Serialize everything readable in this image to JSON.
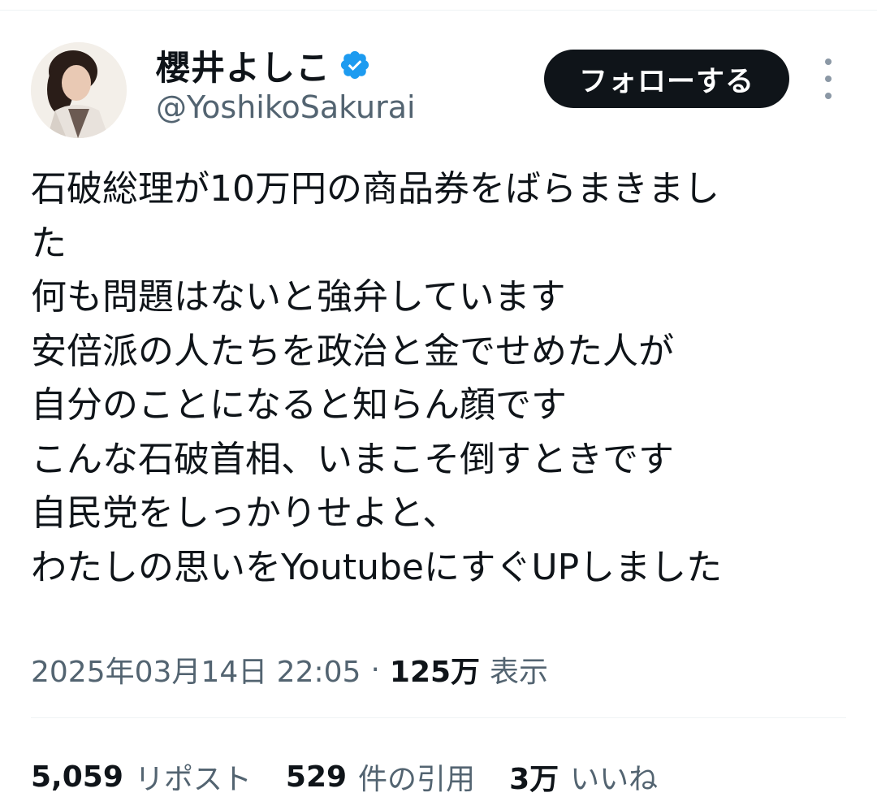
{
  "author": {
    "display_name": "櫻井よしこ",
    "handle": "@YoshikoSakurai",
    "verified": true,
    "avatar_icon": "profile-photo"
  },
  "actions": {
    "follow_label": "フォローする",
    "more_icon": "more-vertical-icon"
  },
  "tweet": {
    "lines": [
      "石破総理が10万円の商品券をばらまきまし",
      "た",
      "何も問題はないと強弁しています",
      "安倍派の人たちを政治と金でせめた人が",
      "自分のことになると知らん顔です",
      "こんな石破首相、いまこそ倒すときです",
      "自民党をしっかりせよと、",
      "わたしの思いをYoutubeにすぐUPしました"
    ]
  },
  "meta": {
    "timestamp": "2025年03月14日 22:05",
    "separator": "·",
    "views_count": "125万",
    "views_label": "表示"
  },
  "stats": {
    "reposts_count": "5,059",
    "reposts_label": "リポスト",
    "quotes_count": "529",
    "quotes_label": "件の引用",
    "likes_count": "3万",
    "likes_label": "いいね"
  },
  "colors": {
    "text_primary": "#0f1419",
    "text_secondary": "#536471",
    "verified_blue": "#1d9bf0",
    "follow_bg": "#0f1419",
    "divider": "#eff3f4"
  }
}
